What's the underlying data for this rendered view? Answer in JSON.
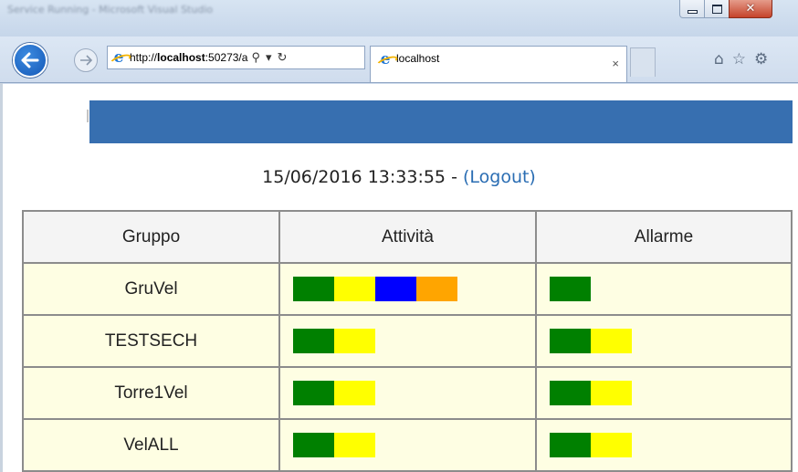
{
  "window": {
    "title": "Service Running - Microsoft Visual Studio"
  },
  "browser": {
    "url_prefix": "http://",
    "url_host": "localhost",
    "url_suffix": ":50273/a",
    "tab_title": "localhost",
    "tab_close": "×"
  },
  "page": {
    "datetime": "15/06/2016 13:33:55",
    "separator": " - ",
    "logout_label": "(Logout)",
    "columns": [
      "Gruppo",
      "Attività",
      "Allarme"
    ],
    "rows": [
      {
        "name": "GruVel",
        "attivita": [
          "#008000",
          "#ffff00",
          "#0000ff",
          "#ffa500"
        ],
        "allarme": [
          "#008000"
        ]
      },
      {
        "name": "TESTSECH",
        "attivita": [
          "#008000",
          "#ffff00"
        ],
        "allarme": [
          "#008000",
          "#ffff00"
        ]
      },
      {
        "name": "Torre1Vel",
        "attivita": [
          "#008000",
          "#ffff00"
        ],
        "allarme": [
          "#008000",
          "#ffff00"
        ]
      },
      {
        "name": "VelALL",
        "attivita": [
          "#008000",
          "#ffff00"
        ],
        "allarme": [
          "#008000",
          "#ffff00"
        ]
      }
    ]
  },
  "colors": {
    "header_band": "#376fb0",
    "row_background": "#fefee3",
    "link": "#2a6db3"
  }
}
